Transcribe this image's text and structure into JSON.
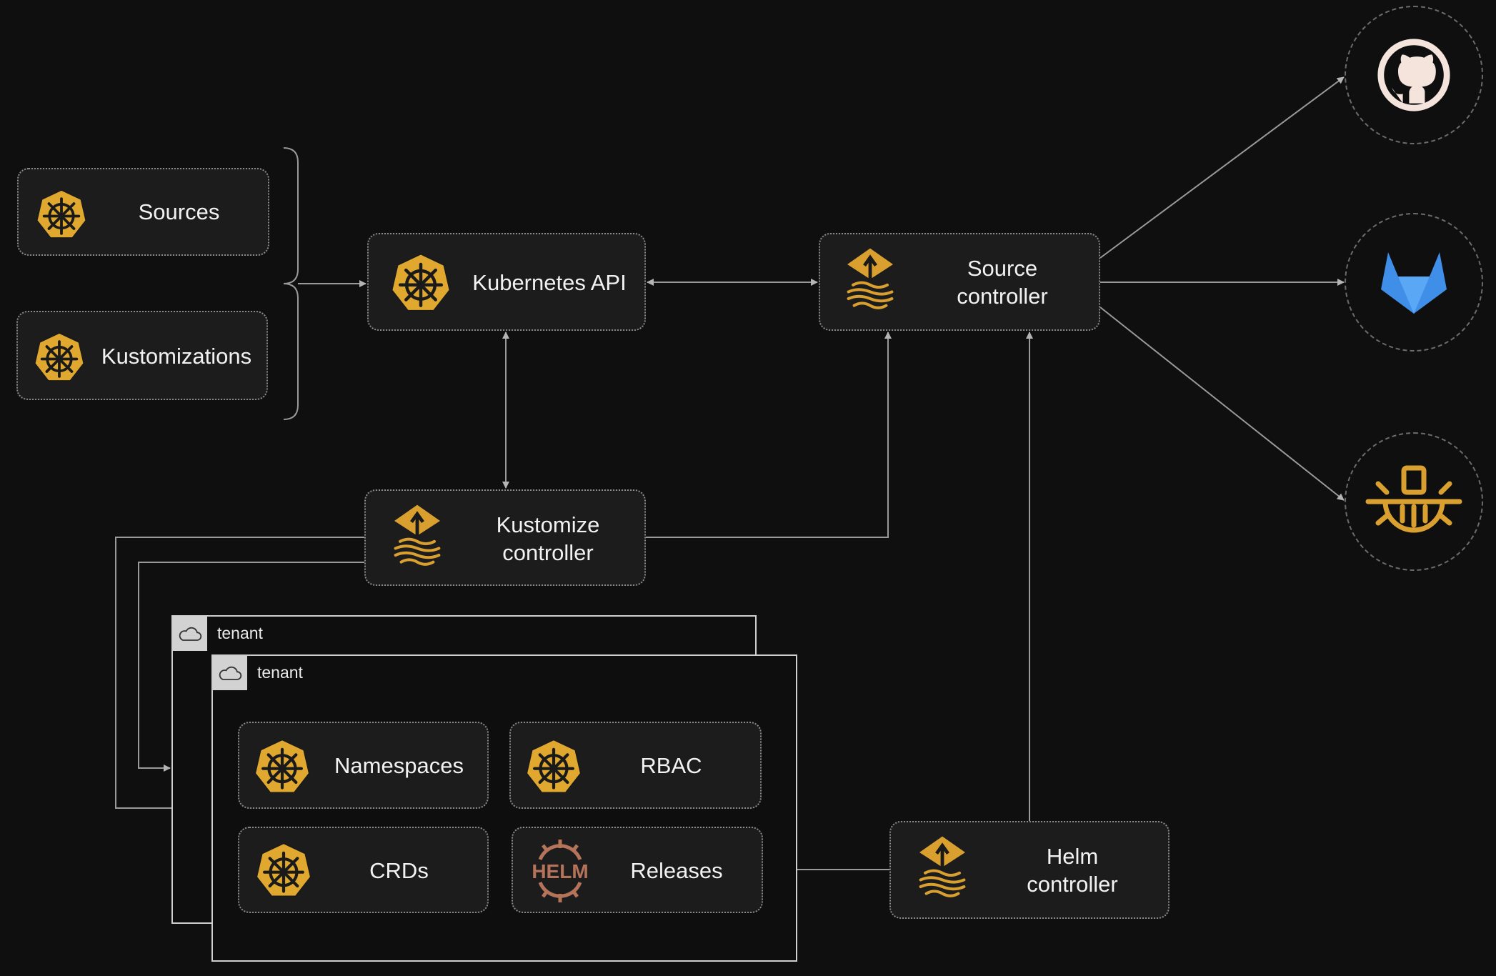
{
  "colors": {
    "background": "#0f0f0f",
    "node_fill": "#1c1c1d",
    "k8s_gold": "#e0a82e",
    "flux_gold": "#d9a030",
    "helm": "#b5735a",
    "gitlab": "#3f8ee8",
    "line": "#9a9a9a"
  },
  "nodes": {
    "sources": {
      "label": "Sources",
      "icon": "kubernetes-icon"
    },
    "kustomizations": {
      "label": "Kustomizations",
      "icon": "kubernetes-icon"
    },
    "kubernetes_api": {
      "label": "Kubernetes API",
      "icon": "kubernetes-icon"
    },
    "source_controller": {
      "label_line1": "Source",
      "label_line2": "controller",
      "icon": "flux-icon"
    },
    "kustomize_controller": {
      "label_line1": "Kustomize",
      "label_line2": "controller",
      "icon": "flux-icon"
    },
    "helm_controller": {
      "label_line1": "Helm",
      "label_line2": "controller",
      "icon": "flux-icon"
    },
    "namespaces": {
      "label": "Namespaces",
      "icon": "kubernetes-icon"
    },
    "rbac": {
      "label": "RBAC",
      "icon": "kubernetes-icon"
    },
    "crds": {
      "label": "CRDs",
      "icon": "kubernetes-icon"
    },
    "releases": {
      "label": "Releases",
      "icon": "helm-icon",
      "logo_text": "HELM"
    }
  },
  "tenants": [
    {
      "label": "tenant",
      "icon": "cloud-icon"
    },
    {
      "label": "tenant",
      "icon": "cloud-icon"
    }
  ],
  "external_sources": [
    {
      "icon": "github-icon"
    },
    {
      "icon": "gitlab-icon"
    },
    {
      "icon": "oci-registry-icon"
    }
  ]
}
